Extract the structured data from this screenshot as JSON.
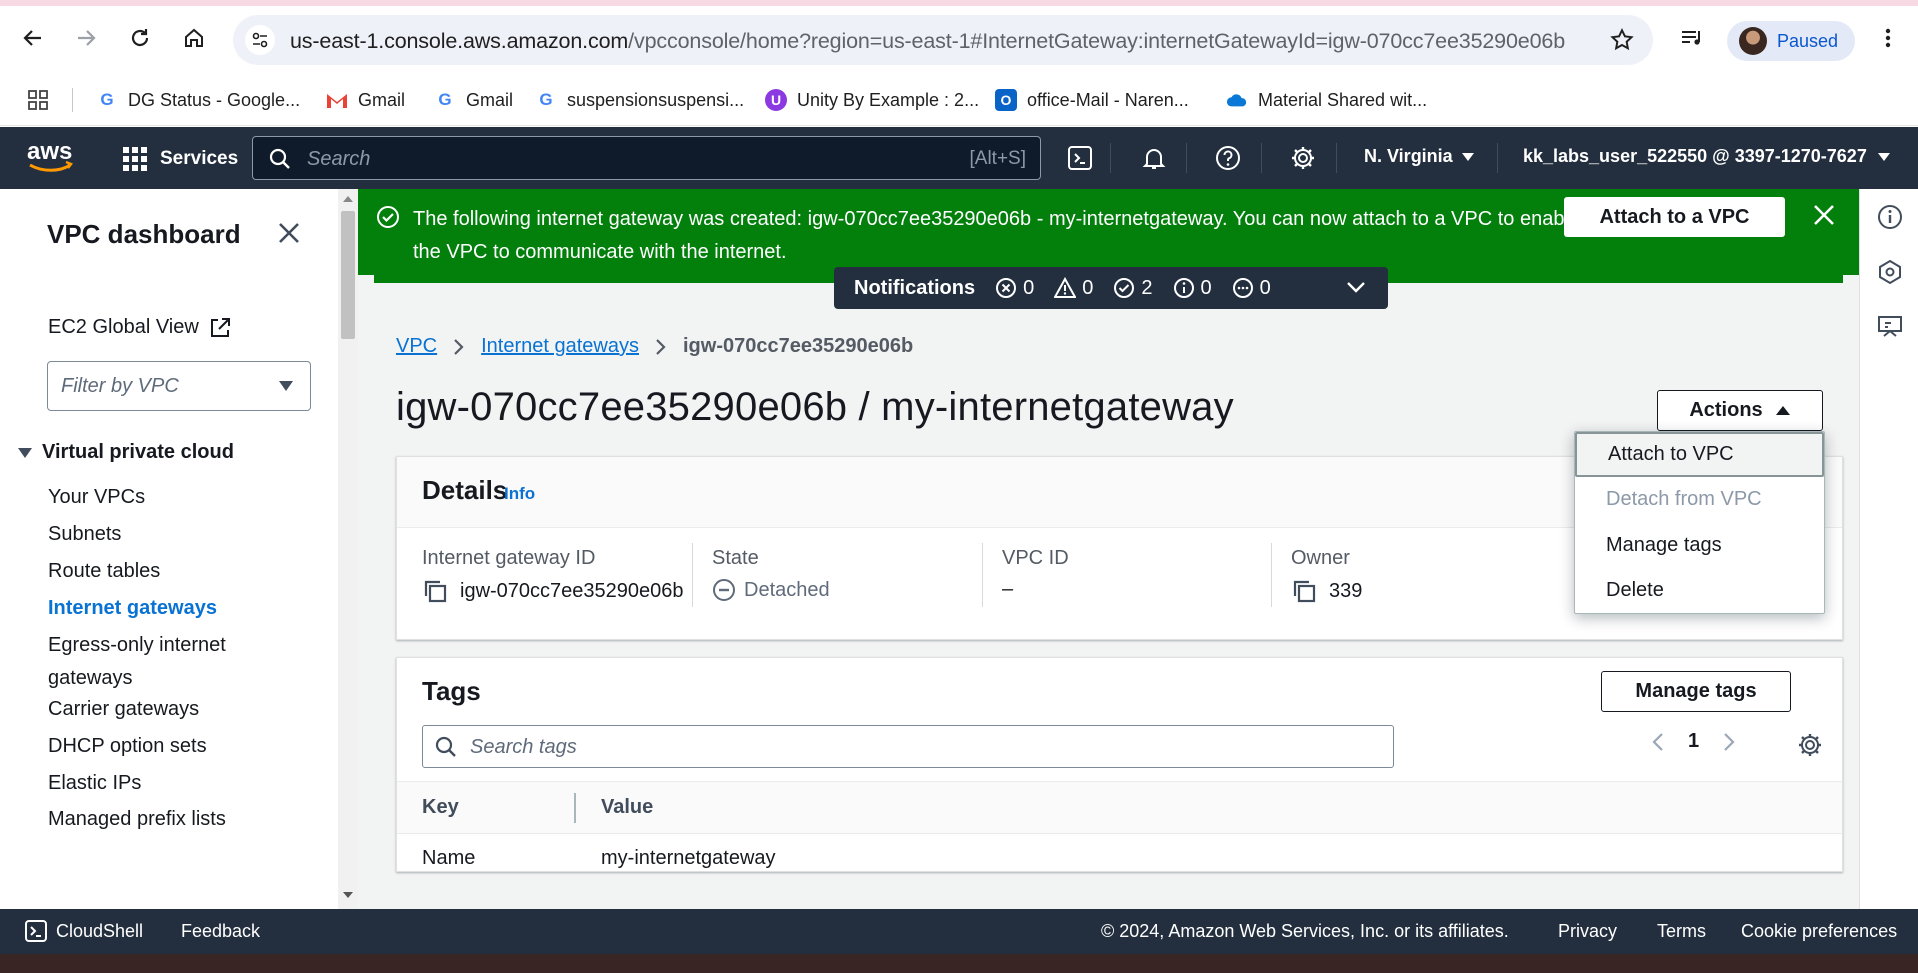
{
  "browser": {
    "url_host": "us-east-1.console.aws.amazon.com",
    "url_path": "/vpcconsole/home?region=us-east-1#InternetGateway:internetGatewayId=igw-070cc7ee35290e06b",
    "profile_label": "Paused",
    "bookmarks": [
      {
        "label": "DG Status - Google...",
        "icon": "google-g-icon"
      },
      {
        "label": "Gmail",
        "icon": "gmail-icon"
      },
      {
        "label": "Gmail",
        "icon": "google-g-icon"
      },
      {
        "label": "suspensionsuspensi...",
        "icon": "google-g-icon"
      },
      {
        "label": "Unity By Example : 2...",
        "icon": "unity-icon"
      },
      {
        "label": "office-Mail - Naren...",
        "icon": "outlook-icon"
      },
      {
        "label": "Material Shared wit...",
        "icon": "onedrive-icon"
      }
    ]
  },
  "aws_nav": {
    "services_label": "Services",
    "search_placeholder": "Search",
    "search_shortcut": "[Alt+S]",
    "region": "N. Virginia",
    "account": "kk_labs_user_522550 @ 3397-1270-7627"
  },
  "sidebar": {
    "title": "VPC dashboard",
    "ec2_global_view": "EC2 Global View",
    "filter_placeholder": "Filter by VPC",
    "section": "Virtual private cloud",
    "items": [
      {
        "label": "Your VPCs"
      },
      {
        "label": "Subnets"
      },
      {
        "label": "Route tables"
      },
      {
        "label": "Internet gateways"
      },
      {
        "label": "Egress-only internet gateways"
      },
      {
        "label": "Carrier gateways"
      },
      {
        "label": "DHCP option sets"
      },
      {
        "label": "Elastic IPs"
      },
      {
        "label": "Managed prefix lists"
      }
    ]
  },
  "flash": {
    "message": "The following internet gateway was created: igw-070cc7ee35290e06b - my-internetgateway. You can now attach to a VPC to enable the VPC to communicate with the internet.",
    "button": "Attach to a VPC",
    "color": "#037f0c"
  },
  "notifications": {
    "label": "Notifications",
    "counts": {
      "error": "0",
      "warning": "0",
      "success": "2",
      "info": "0",
      "pending": "0"
    }
  },
  "breadcrumb": {
    "vpc": "VPC",
    "igw": "Internet gateways",
    "current": "igw-070cc7ee35290e06b"
  },
  "page_title": "igw-070cc7ee35290e06b / my-internetgateway",
  "actions": {
    "label": "Actions",
    "menu": [
      "Attach to VPC",
      "Detach from VPC",
      "Manage tags",
      "Delete"
    ]
  },
  "details": {
    "title": "Details",
    "info": "Info",
    "igw_id_label": "Internet gateway ID",
    "igw_id": "igw-070cc7ee35290e06b",
    "state_label": "State",
    "state": "Detached",
    "vpc_id_label": "VPC ID",
    "vpc_id": "–",
    "owner_label": "Owner",
    "owner": "339"
  },
  "tags": {
    "title": "Tags",
    "manage_button": "Manage tags",
    "search_placeholder": "Search tags",
    "page": "1",
    "columns": [
      "Key",
      "Value"
    ],
    "rows": [
      {
        "key": "Name",
        "value": "my-internetgateway"
      }
    ]
  },
  "footer": {
    "cloudshell": "CloudShell",
    "feedback": "Feedback",
    "copyright": "© 2024, Amazon Web Services, Inc. or its affiliates.",
    "privacy": "Privacy",
    "terms": "Terms",
    "cookies": "Cookie preferences"
  },
  "colors": {
    "aws_nav": "#232f3e",
    "link": "#0972d3",
    "success": "#037f0c",
    "aws_orange": "#ff9900"
  }
}
